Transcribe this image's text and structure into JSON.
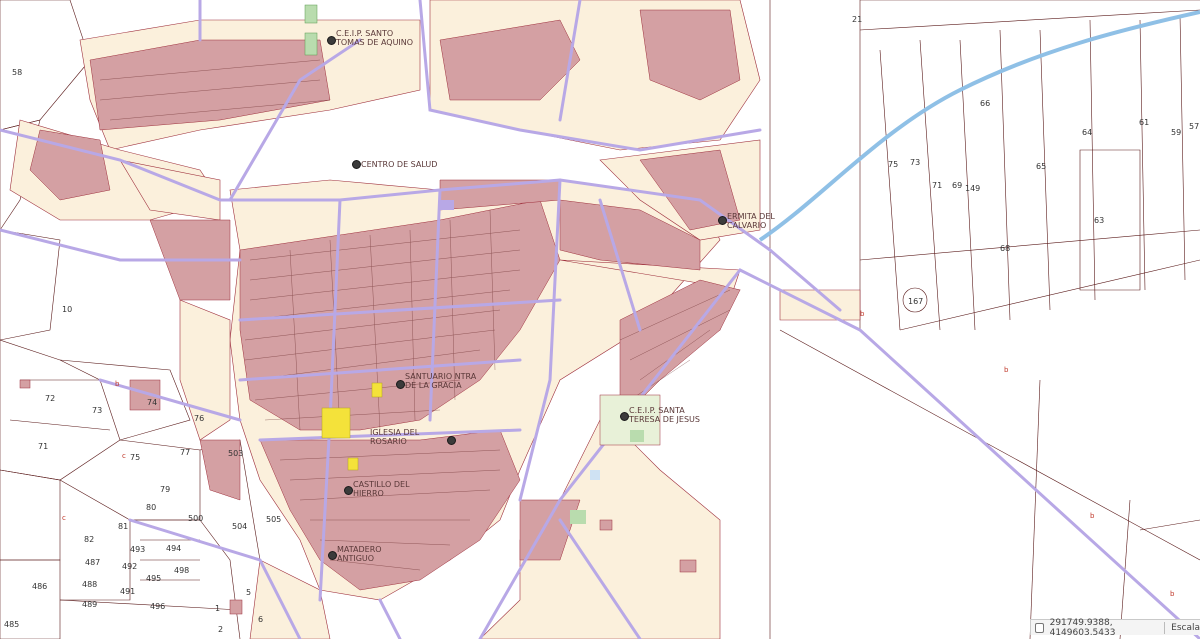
{
  "map": {
    "pois": [
      {
        "line1": "C.E.I.P. SANTO",
        "line2": "TOMAS DE AQUINO",
        "icon": "poi-dot-icon"
      },
      {
        "line1": "CENTRO DE SALUD",
        "line2": "",
        "icon": "poi-dot-icon"
      },
      {
        "line1": "ERMITA DEL",
        "line2": "CALVARIO",
        "icon": "poi-dot-icon"
      },
      {
        "line1": "SANTUARIO NTRA",
        "line2": "DE LA GRACIA",
        "icon": "poi-dot-icon"
      },
      {
        "line1": "C.E.I.P. SANTA",
        "line2": "TERESA DE JESUS",
        "icon": "poi-dot-icon"
      },
      {
        "line1": "IGLESIA DEL",
        "line2": "ROSARIO",
        "icon": "poi-dot-icon"
      },
      {
        "line1": "CASTILLO DEL",
        "line2": "HIERRO",
        "icon": "poi-dot-icon"
      },
      {
        "line1": "MATADERO",
        "line2": "ANTIGUO",
        "icon": "poi-dot-icon"
      }
    ],
    "parcel_numbers": [
      "58",
      "10",
      "72",
      "73",
      "74",
      "76",
      "71",
      "75",
      "77",
      "503",
      "500",
      "80",
      "79",
      "504",
      "505",
      "487",
      "488",
      "489",
      "493",
      "492",
      "491",
      "494",
      "495",
      "496",
      "498",
      "1",
      "2",
      "5",
      "6",
      "486",
      "485",
      "82",
      "81",
      "21",
      "75",
      "73",
      "71",
      "69",
      "149",
      "66",
      "64",
      "65",
      "61",
      "59",
      "57",
      "63",
      "68",
      "167"
    ],
    "lot_letters": [
      "b",
      "b",
      "c",
      "c",
      "b",
      "b",
      "b"
    ],
    "colors": {
      "building": "#d4a0a3",
      "building_edge": "#9e2f3c",
      "block": "#fbf0dc",
      "street": "#b8a8e6",
      "parcel_line": "#5a1a1a",
      "canal": "#8fc0e6",
      "school_green": "#b9dcae",
      "highlight": "#f4e23a"
    }
  },
  "status_bar": {
    "coordinates": "291749.9388, 4149603.5433",
    "scale_label": "Escala"
  }
}
